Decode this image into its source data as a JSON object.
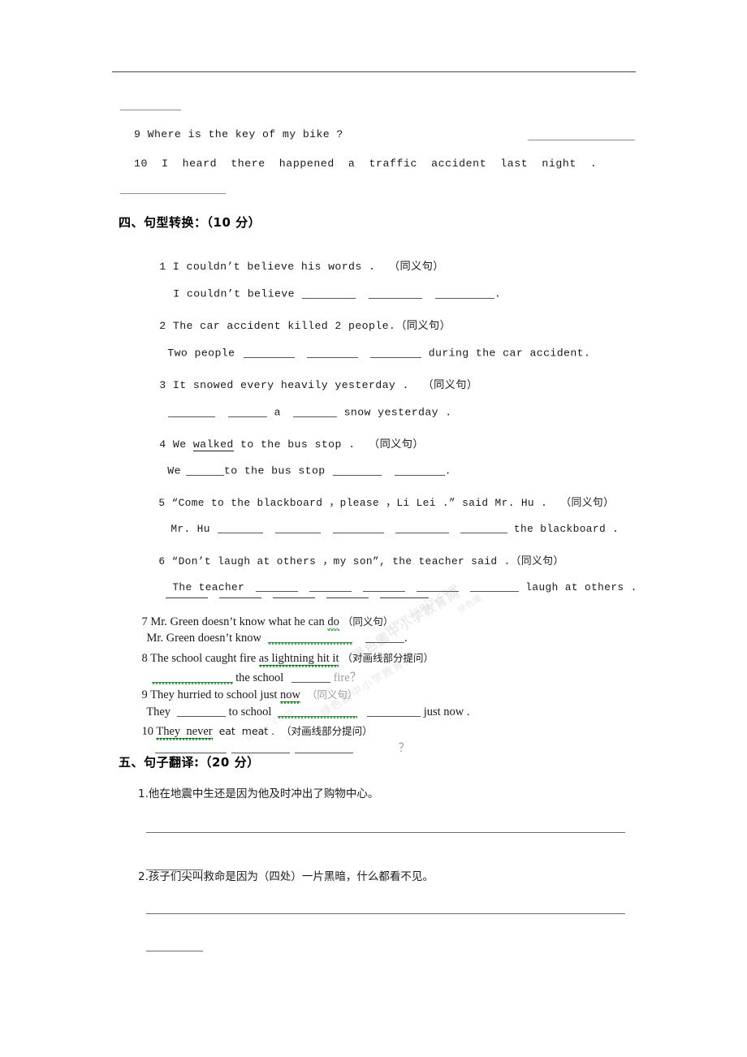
{
  "document": {
    "type": "scanned-exam-paper",
    "language": "zh-CN/en",
    "top_rule": true
  },
  "watermark": {
    "lines": [
      "绿色圃中小学教育网",
      "www.lspjy.com",
      "绿色圃中小学教育网",
      "lspjy.com",
      "绿色圃"
    ]
  },
  "carryover": {
    "q9": "9 Where is the key of my bike ?",
    "q10": "10  I  heard  there  happened  a  traffic  accident  last  night  ."
  },
  "section4": {
    "heading": "四、句型转换：（10 分）",
    "items": [
      {
        "n": "1",
        "prompt": "1 I couldn’t believe his words .  （同义句）",
        "answer_prefix": "I couldn’t believe",
        "answer_suffix": ".",
        "blanks": 3
      },
      {
        "n": "2",
        "prompt": "2 The car accident killed 2 people.（同义句）",
        "answer_prefix": "Two people",
        "answer_suffix": "during the car accident.",
        "blanks": 3
      },
      {
        "n": "3",
        "prompt": "3 It snowed every heavily yesterday .  （同义句）",
        "answer_prefix": "",
        "answer_mid": "a",
        "answer_suffix": "snow yesterday .",
        "blanks": 3
      },
      {
        "n": "4",
        "prompt_a": "4 We ",
        "prompt_underlined": "walked",
        "prompt_b": " to the bus stop .  （同义句）",
        "answer_prefix": "We",
        "answer_mid": "to the bus stop",
        "answer_suffix": ".",
        "blanks": 3
      },
      {
        "n": "5",
        "prompt": "5 “Come to the blackboard ，please ，Li Lei .” said Mr. Hu .  （同义句）",
        "answer_prefix": "Mr. Hu",
        "answer_suffix": "the blackboard .",
        "blanks": 5
      },
      {
        "n": "6",
        "prompt": "6 “Don’t laugh at others ，my son”, the teacher said .（同义句）",
        "answer_prefix": "The teacher",
        "answer_suffix": "laugh at others .",
        "blanks": 5
      },
      {
        "n": "7",
        "prompt_a": "7 Mr. Green doesn’t know what he can ",
        "prompt_spell": "do",
        "prompt_b": " （同义句）",
        "answer_prefix": "Mr. Green doesn’t know",
        "answer_suffix": ".",
        "blanks": 2
      },
      {
        "n": "8",
        "prompt_a": "8 The school caught fire ",
        "prompt_underlined": "as lightning hit it",
        "prompt_b": " （对画线部分提问）",
        "answer_mid": "the school",
        "answer_suffix": "fire？",
        "blanks": 2
      },
      {
        "n": "9",
        "prompt_a": "9 They hurried to school just ",
        "prompt_spell": "now",
        "prompt_b": "  （同义句）",
        "answer_prefix": "They",
        "answer_mid": "to school",
        "answer_suffix": "just now .",
        "blanks": 3
      },
      {
        "n": "10",
        "prompt_a": "10 ",
        "prompt_underlined": "They  never",
        "prompt_b": "  eat  meat .  （对画线部分提问）",
        "answer_suffix": "？",
        "blanks": 3
      }
    ]
  },
  "section5": {
    "heading": "五、句子翻译:（20 分）",
    "items": [
      {
        "n": "1.",
        "text": "1.他在地震中生还是因为他及时冲出了购物中心。"
      },
      {
        "n": "2.",
        "text": "2.孩子们尖叫救命是因为（四处）一片黑暗，什么都看不见。"
      }
    ]
  }
}
